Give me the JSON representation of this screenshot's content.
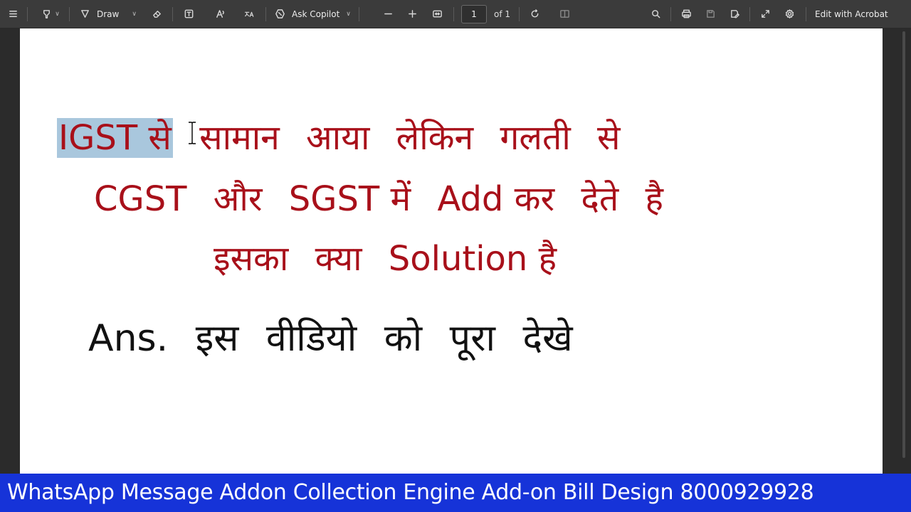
{
  "toolbar": {
    "draw_label": "Draw",
    "ask_copilot_label": "Ask Copilot",
    "page_number": "1",
    "page_of": "of 1",
    "edit_acrobat_label": "Edit with Acrobat"
  },
  "document": {
    "line1": {
      "selected": "IGST से",
      "words": [
        "सामान",
        "आया",
        "लेकिन",
        "गलती",
        "से"
      ]
    },
    "line2": {
      "words": [
        "CGST",
        "और",
        "SGST में",
        "Add कर",
        "देते",
        "है"
      ]
    },
    "line3": {
      "words": [
        "इसका",
        "क्या",
        "Solution है"
      ]
    },
    "line4": {
      "words": [
        "Ans.",
        "इस",
        "वीडियो",
        "को",
        "पूरा",
        "देखे"
      ]
    }
  },
  "banner": {
    "text": "WhatsApp Message Addon Collection Engine Add-on Bill Design 8000929928"
  },
  "colors": {
    "text_red": "#a8101a",
    "selection": "#a9c7dd",
    "banner_blue": "#1633d8"
  }
}
